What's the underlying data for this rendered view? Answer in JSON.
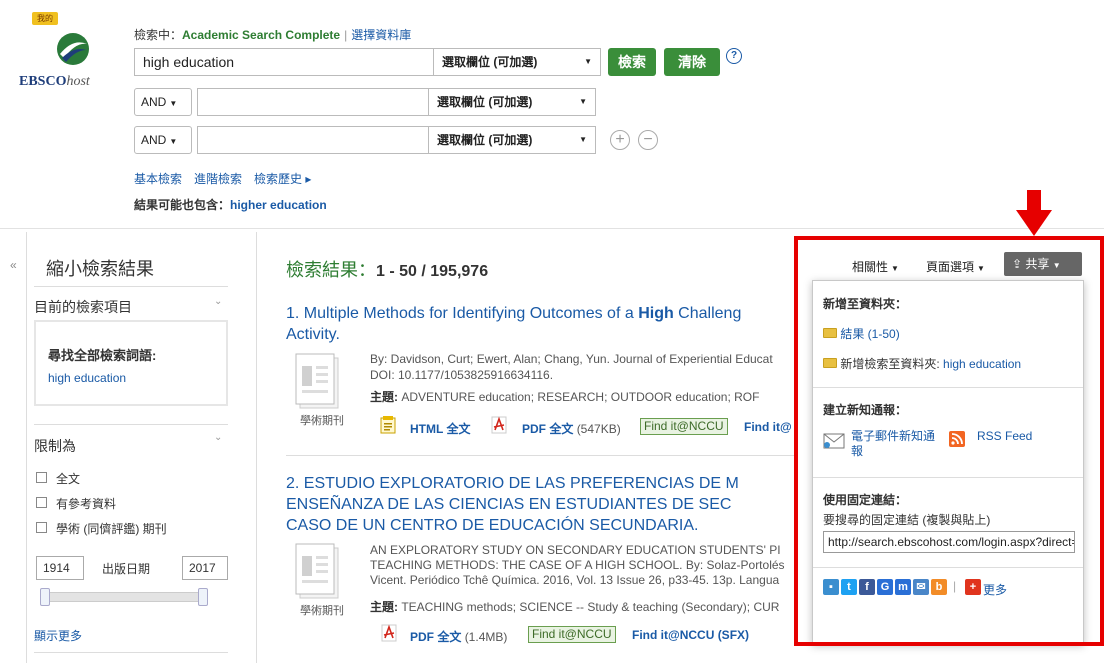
{
  "logo": {
    "badge": "我的",
    "brand": "EBSCO",
    "brand_suffix": "host"
  },
  "search": {
    "searching_prefix": "檢索中：",
    "database": "Academic Search Complete",
    "choose_db": "選擇資料庫",
    "rows": [
      {
        "bool": "",
        "term": "high education",
        "field": "選取欄位 (可加選)"
      },
      {
        "bool": "AND",
        "term": "",
        "field": "選取欄位 (可加選)"
      },
      {
        "bool": "AND",
        "term": "",
        "field": "選取欄位 (可加選)"
      }
    ],
    "search_btn": "檢索",
    "clear_btn": "清除",
    "help": "?",
    "add_row": "+",
    "remove_row": "−",
    "links": {
      "basic": "基本檢索",
      "advanced": "進階檢索",
      "history": "檢索歷史 ▸"
    },
    "also_label": "結果可能也包含：",
    "also_term": "higher education"
  },
  "sidebar": {
    "collapse": "«",
    "title": "縮小檢索結果",
    "current_label": "目前的檢索項目",
    "find_all": "尋找全部檢索詞語:",
    "find_term": "high education",
    "limit_label": "限制為",
    "limits": [
      "全文",
      "有參考資料",
      "學術 (同儕評鑑) 期刊"
    ],
    "year_from": "1914",
    "year_to": "2017",
    "pub_date": "出版日期",
    "show_more": "顯示更多"
  },
  "results": {
    "header_label": "檢索結果：",
    "header_range": "1 - 50 / 195,976",
    "items": [
      {
        "num": "1.",
        "title_a": "Multiple Methods for Identifying Outcomes of a ",
        "title_b": "High",
        "title_c": " Challeng",
        "title_line2": "Activity.",
        "type": "學術期刊",
        "meta1": "By: Davidson, Curt; Ewert, Alan; Chang, Yun. Journal of Experiential Educat",
        "meta2": "DOI: 10.1177/1053825916634116.",
        "subject_label": "主題:",
        "subjects": "ADVENTURE education; RESEARCH; OUTDOOR education; ROF",
        "html_ft": "HTML 全文",
        "pdf_ft": "PDF 全文",
        "pdf_size": "(547KB)",
        "findit": "Find it@NCCU",
        "findit_sfx": "Find it@"
      },
      {
        "num": "2.",
        "title_line1": "ESTUDIO EXPLORATORIO DE LAS PREFERENCIAS DE M",
        "title_line2": "ENSEÑANZA DE LAS CIENCIAS EN ESTUDIANTES DE SEC",
        "title_line3": "CASO DE UN CENTRO DE EDUCACIÓN SECUNDARIA.",
        "type": "學術期刊",
        "meta1": "AN EXPLORATORY STUDY ON SECONDARY EDUCATION STUDENTS' PI",
        "meta2": "TEACHING METHODS: THE CASE OF A HIGH SCHOOL. By: Solaz-Portolés",
        "meta3": "Vicent. Periódico Tchê Química. 2016, Vol. 13 Issue 26, p33-45. 13p. Langua",
        "subject_label": "主題:",
        "subjects": "TEACHING methods; SCIENCE -- Study & teaching (Secondary); CUR",
        "pdf_ft": "PDF 全文",
        "pdf_size": "(1.4MB)",
        "findit": "Find it@NCCU",
        "findit_sfx": "Find it@NCCU (SFX)"
      }
    ]
  },
  "toolbar": {
    "relevance": "相關性",
    "page_options": "頁面選項",
    "share": "共享"
  },
  "share_panel": {
    "add_folder_head": "新增至資料夾：",
    "results_link": "結果 (1-50)",
    "add_search_prefix": "新增檢索至資料夾: ",
    "add_search_term": "high education",
    "alert_head": "建立新知通報：",
    "email_alert": "電子郵件新知通報",
    "rss": "RSS Feed",
    "perm_head": "使用固定連結：",
    "perm_desc": "要搜尋的固定連結 (複製與貼上)",
    "perm_url": "http://search.ebscohost.com/login.aspx?direct=true",
    "more": "更多"
  },
  "colors": {
    "accent_green": "#3a8e3a",
    "link_blue": "#1a5aa6",
    "highlight_red": "#e60000"
  }
}
